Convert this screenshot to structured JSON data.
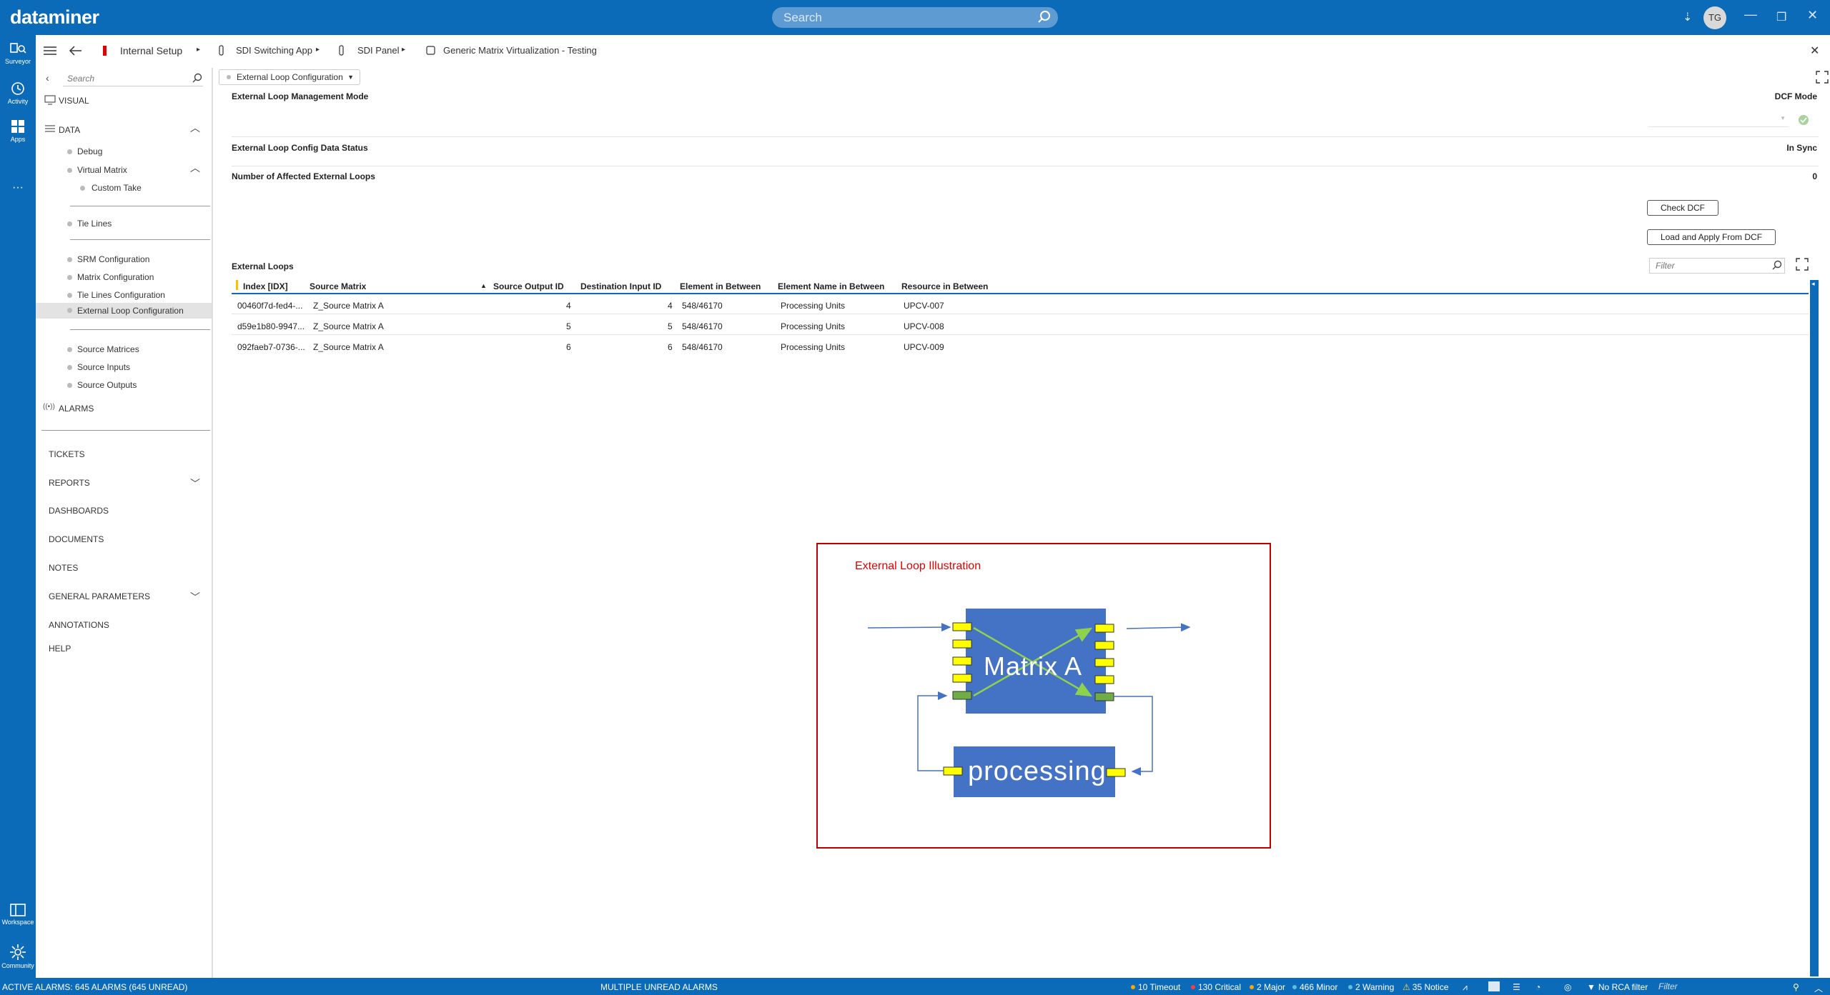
{
  "app": {
    "logo": "dataminer",
    "search_placeholder": "Search",
    "user_initials": "TG"
  },
  "rail": {
    "surveyor": "Surveyor",
    "activity": "Activity",
    "apps": "Apps",
    "more": "···",
    "workspace": "Workspace",
    "community": "Community"
  },
  "breadcrumb": {
    "items": [
      "Internal Setup",
      "SDI Switching App",
      "SDI Panel",
      "Generic Matrix Virtualization - Testing"
    ]
  },
  "nav": {
    "search_placeholder": "Search",
    "visual": "VISUAL",
    "data": "DATA",
    "debug": "Debug",
    "virtual_matrix": "Virtual Matrix",
    "custom_take": "Custom Take",
    "tie_lines": "Tie Lines",
    "srm_configuration": "SRM Configuration",
    "matrix_configuration": "Matrix Configuration",
    "tie_lines_configuration": "Tie Lines Configuration",
    "external_loop_configuration": "External Loop Configuration",
    "source_matrices": "Source Matrices",
    "source_inputs": "Source Inputs",
    "source_outputs": "Source Outputs",
    "alarms": "ALARMS",
    "tickets": "TICKETS",
    "reports": "REPORTS",
    "dashboards": "DASHBOARDS",
    "documents": "DOCUMENTS",
    "notes": "NOTES",
    "general_parameters": "GENERAL PARAMETERS",
    "annotations": "ANNOTATIONS",
    "help": "HELP"
  },
  "page": {
    "selector": "External Loop Configuration",
    "mgmt_mode_label": "External Loop Management Mode",
    "mgmt_mode_value": "DCF Mode",
    "config_status_label": "External Loop Config Data Status",
    "config_status_value": "In Sync",
    "affected_label": "Number of Affected External Loops",
    "affected_value": "0",
    "check_dcf": "Check DCF",
    "load_apply": "Load and Apply From DCF",
    "table_title": "External Loops",
    "filter_placeholder": "Filter"
  },
  "table": {
    "columns": [
      "Index [IDX]",
      "Source Matrix",
      "Source Output ID",
      "Destination Input ID",
      "Element in Between",
      "Element Name in Between",
      "Resource in Between"
    ],
    "rows": [
      [
        "00460f7d-fed4-...",
        "Z_Source Matrix A",
        "4",
        "4",
        "548/46170",
        "Processing Units",
        "UPCV-007"
      ],
      [
        "d59e1b80-9947...",
        "Z_Source Matrix A",
        "5",
        "5",
        "548/46170",
        "Processing Units",
        "UPCV-008"
      ],
      [
        "092faeb7-0736-...",
        "Z_Source Matrix A",
        "6",
        "6",
        "548/46170",
        "Processing Units",
        "UPCV-009"
      ]
    ]
  },
  "illustration": {
    "title": "External Loop Illustration",
    "matrix_label": "Matrix A",
    "processing_label": "processing"
  },
  "status": {
    "active_alarms": "ACTIVE ALARMS: 645 ALARMS (645 UNREAD)",
    "multiple_unread": "MULTIPLE UNREAD ALARMS",
    "timeout": "10 Timeout",
    "critical": "130 Critical",
    "major": "2 Major",
    "minor": "466 Minor",
    "warning": "2 Warning",
    "notice": "35 Notice",
    "rca": "No RCA filter",
    "filter_placeholder": "Filter"
  },
  "colors": {
    "brand": "#0c6bb8",
    "critical": "#ff3b3b",
    "major": "#ffa500",
    "minor": "#5bc0de",
    "warning": "#ffd24d",
    "illustration_border": "#c00000",
    "matrix_fill": "#4472c4"
  }
}
